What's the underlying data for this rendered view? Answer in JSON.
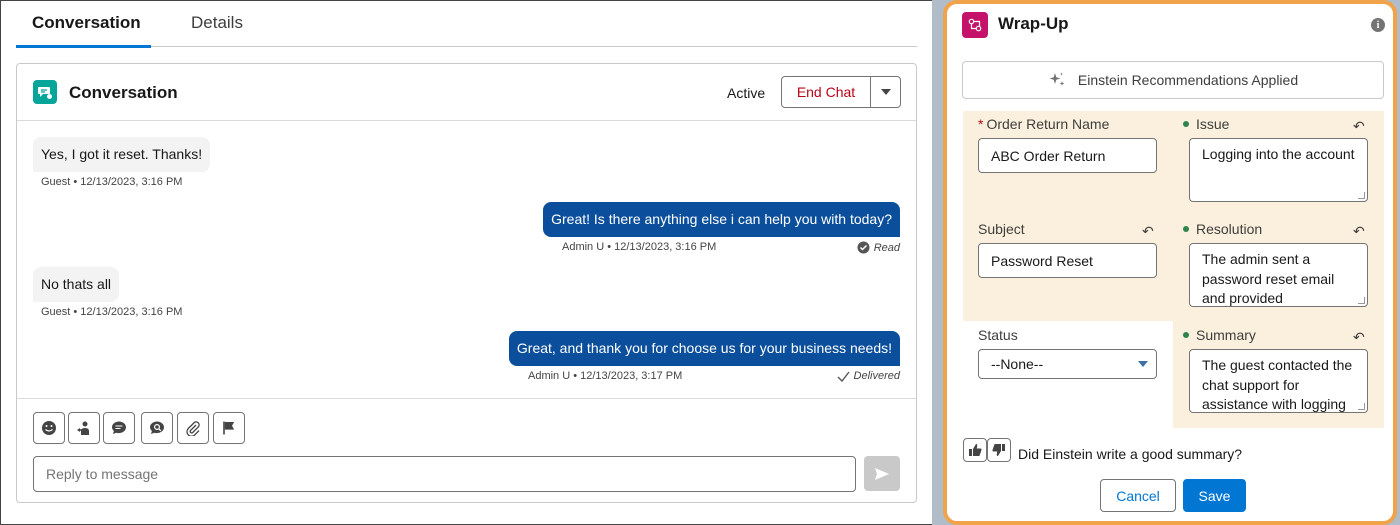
{
  "tabs": [
    {
      "label": "Conversation",
      "active": true
    },
    {
      "label": "Details",
      "active": false
    }
  ],
  "conversation": {
    "title": "Conversation",
    "status": "Active",
    "end_chat_label": "End Chat",
    "messages": [
      {
        "direction": "in",
        "text": "Yes, I got it reset. Thanks!",
        "meta": "Guest • 12/13/2023, 3:16 PM"
      },
      {
        "direction": "out",
        "text": "Great! Is there anything else i can help you with today?",
        "meta": "Admin U • 12/13/2023, 3:16 PM",
        "receipt": "Read"
      },
      {
        "direction": "in",
        "text": "No thats all",
        "meta": "Guest • 12/13/2023, 3:16 PM"
      },
      {
        "direction": "out",
        "text": "Great, and thank you for choose us for your business needs!",
        "meta": "Admin U • 12/13/2023, 3:17 PM",
        "receipt": "Delivered"
      }
    ],
    "toolbar_icons": [
      "emoji-icon",
      "transfer-icon",
      "quick-text-icon",
      "knowledge-icon",
      "attach-icon",
      "flag-icon"
    ],
    "reply_placeholder": "Reply to message"
  },
  "wrapup": {
    "title": "Wrap-Up",
    "einstein_banner": "Einstein Recommendations Applied",
    "fields": {
      "order_return_name": {
        "label": "Order Return Name",
        "required": true,
        "value": "ABC Order Return"
      },
      "issue": {
        "label": "Issue",
        "ai": true,
        "value": "Logging into the account"
      },
      "subject": {
        "label": "Subject",
        "value": "Password Reset"
      },
      "resolution": {
        "label": "Resolution",
        "ai": true,
        "value": "The admin sent a password reset email and provided"
      },
      "status": {
        "label": "Status",
        "value": "--None--"
      },
      "summary": {
        "label": "Summary",
        "ai": true,
        "value": "The guest contacted the chat support for assistance with logging"
      }
    },
    "feedback_question": "Did Einstein write a good summary?",
    "cancel_label": "Cancel",
    "save_label": "Save"
  },
  "colors": {
    "brand_blue": "#0176d3",
    "outgoing_bubble": "#0b4f9c",
    "highlight": "#fbf0de",
    "focus_border": "#f0a34a",
    "end_chat_text": "#ba0517"
  }
}
